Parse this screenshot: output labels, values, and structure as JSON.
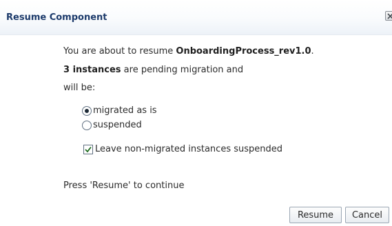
{
  "dialog": {
    "title": "Resume Component",
    "message": {
      "line1_prefix": "You are about to resume ",
      "component_name": "OnboardingProcess_rev1.0",
      "line1_suffix": ".",
      "instances_bold": "3 instances",
      "line2_rest": " are pending migration and",
      "line3": "will be:"
    },
    "options": [
      {
        "label": "migrated as is",
        "selected": true
      },
      {
        "label": "suspended",
        "selected": false
      }
    ],
    "checkbox": {
      "label": "Leave non-migrated instances suspended",
      "checked": true
    },
    "footer_text": "Press 'Resume' to continue",
    "buttons": {
      "resume_label": "Resume",
      "cancel_label": "Cancel"
    },
    "icons": {
      "close": "close-icon",
      "radio": "radio-icon",
      "check": "checkmark-icon"
    }
  }
}
